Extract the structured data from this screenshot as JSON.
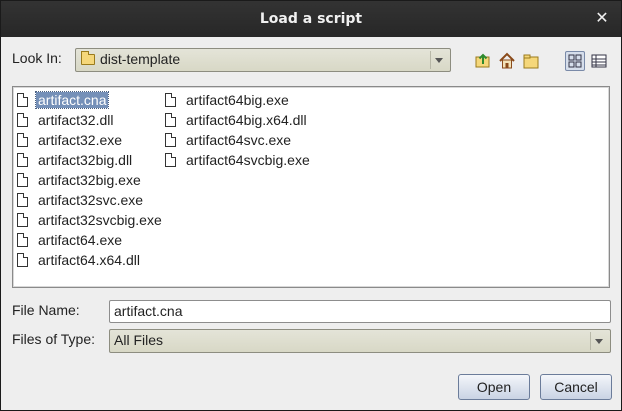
{
  "window": {
    "title": "Load a script",
    "close_glyph": "✕"
  },
  "look_in": {
    "label": "Look In:",
    "value": "dist-template"
  },
  "toolbar": {
    "buttons": [
      {
        "name": "up-folder-icon"
      },
      {
        "name": "home-icon"
      },
      {
        "name": "new-folder-icon"
      },
      {
        "name": "list-view-icon",
        "toggled": true
      },
      {
        "name": "details-view-icon",
        "toggled": false
      }
    ]
  },
  "files": {
    "columns": [
      [
        "artifact.cna",
        "artifact32.dll",
        "artifact32.exe",
        "artifact32big.dll",
        "artifact32big.exe",
        "artifact32svc.exe",
        "artifact32svcbig.exe",
        "artifact64.exe",
        "artifact64.x64.dll"
      ],
      [
        "artifact64big.exe",
        "artifact64big.x64.dll",
        "artifact64svc.exe",
        "artifact64svcbig.exe"
      ]
    ],
    "selected": "artifact.cna"
  },
  "file_name": {
    "label": "File Name:",
    "value": "artifact.cna"
  },
  "file_type": {
    "label": "Files of Type:",
    "value": "All Files"
  },
  "buttons": {
    "open": "Open",
    "cancel": "Cancel"
  }
}
